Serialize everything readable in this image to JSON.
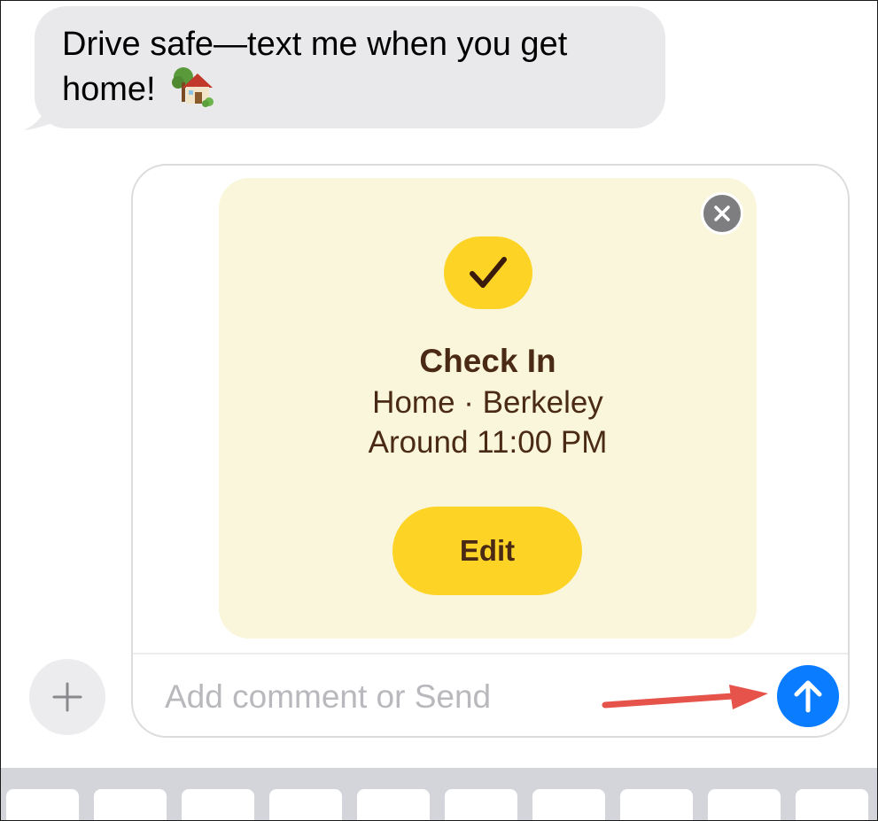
{
  "conversation": {
    "incoming_message": {
      "text": "Drive safe—text me when you get home!",
      "emoji": "house-with-garden"
    }
  },
  "check_in_card": {
    "title": "Check In",
    "location": "Home · Berkeley",
    "time": "Around 11:00 PM",
    "edit_label": "Edit",
    "icon": "checkmark-icon",
    "close_icon": "close-icon"
  },
  "composer": {
    "placeholder": "Add comment or Send",
    "value": "",
    "send_icon": "arrow-up-icon",
    "add_icon": "plus-icon"
  },
  "colors": {
    "card_background": "#faf6dc",
    "card_accent_yellow": "#fdd426",
    "card_text_brown": "#4a2a14",
    "send_blue": "#0a7cff",
    "bubble_gray": "#e9e9eb",
    "annotation_arrow": "#e5534b"
  },
  "keyboard": {
    "visible_key_count": 10
  }
}
